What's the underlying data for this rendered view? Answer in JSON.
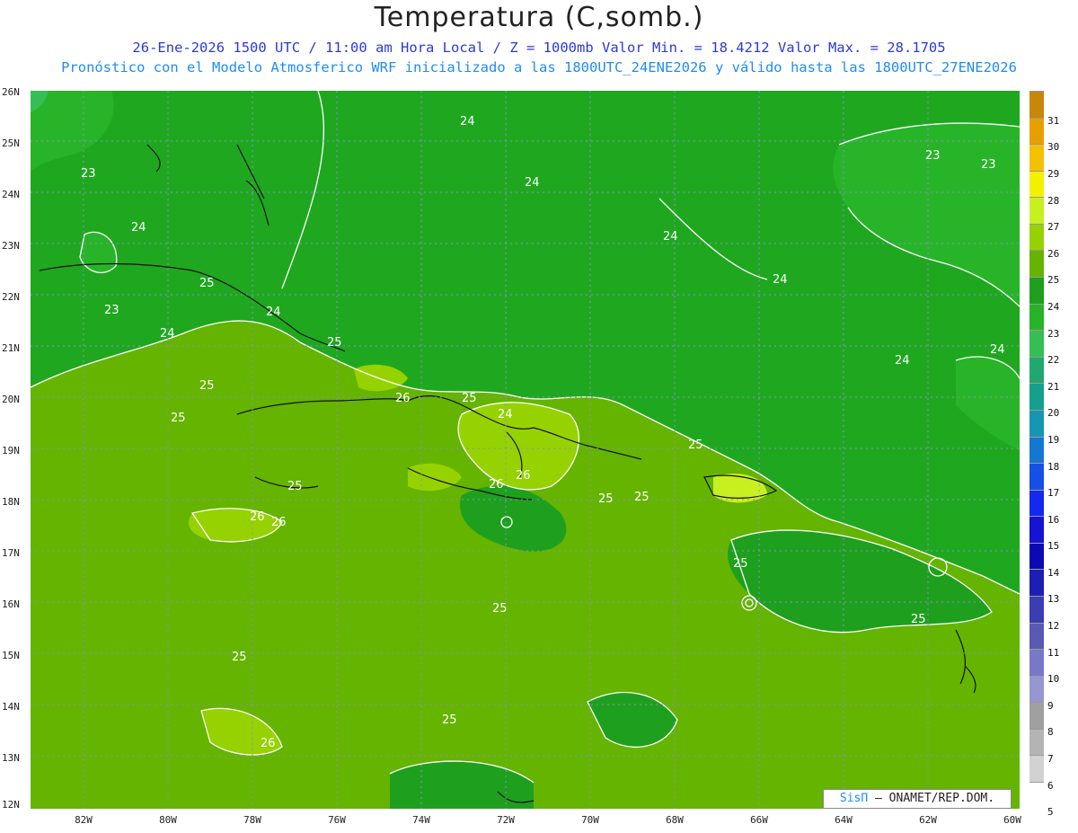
{
  "title": "Temperatura (C,somb.)",
  "subtitle_line1": "26-Ene-2026 1500 UTC / 11:00 am Hora Local / Z = 1000mb  Valor Min. = 18.4212  Valor Max. = 28.1705",
  "subtitle_line2": "Pronóstico con el Modelo Atmosferico WRF inicializado a las 1800UTC_24ENE2026 y válido hasta las  1800UTC_27ENE2026",
  "lat_labels": [
    "26N",
    "25N",
    "24N",
    "23N",
    "22N",
    "21N",
    "20N",
    "19N",
    "18N",
    "17N",
    "16N",
    "15N",
    "14N",
    "13N",
    "12N"
  ],
  "lon_labels": [
    "82W",
    "80W",
    "78W",
    "76W",
    "74W",
    "72W",
    "70W",
    "68W",
    "66W",
    "64W",
    "62W",
    "60W"
  ],
  "contour_labels": [
    "24",
    "23",
    "24",
    "24",
    "24",
    "23",
    "24",
    "24",
    "25",
    "24",
    "23",
    "24",
    "25",
    "25",
    "26",
    "25",
    "24",
    "25",
    "25",
    "26",
    "26",
    "25",
    "26",
    "26",
    "25",
    "25",
    "25",
    "25",
    "25",
    "25",
    "26",
    "25",
    "24",
    "23",
    "23"
  ],
  "colorbar": {
    "levels": [
      "31",
      "30",
      "29",
      "28",
      "27",
      "26",
      "25",
      "24",
      "23",
      "22",
      "21",
      "20",
      "19",
      "18",
      "17",
      "16",
      "15",
      "14",
      "13",
      "12",
      "11",
      "10",
      "9",
      "8",
      "7",
      "6",
      "5"
    ],
    "colors": [
      "#c8860a",
      "#e8a000",
      "#f5c000",
      "#f5f000",
      "#c8f020",
      "#96d200",
      "#64b400",
      "#1ea01e",
      "#28b428",
      "#34be54",
      "#20a870",
      "#14a08c",
      "#1496b4",
      "#1478d2",
      "#1450e6",
      "#1428f0",
      "#1414d2",
      "#0a0ab4",
      "#1e1eb4",
      "#3c3cb4",
      "#5a5ab4",
      "#7878c8",
      "#9696d2",
      "#a0a0a0",
      "#b4b4b4",
      "#d2d2d2",
      "#ffffff"
    ]
  },
  "credit": {
    "brand": "SisΠ",
    "text": "– ONAMET/REP.DOM."
  }
}
